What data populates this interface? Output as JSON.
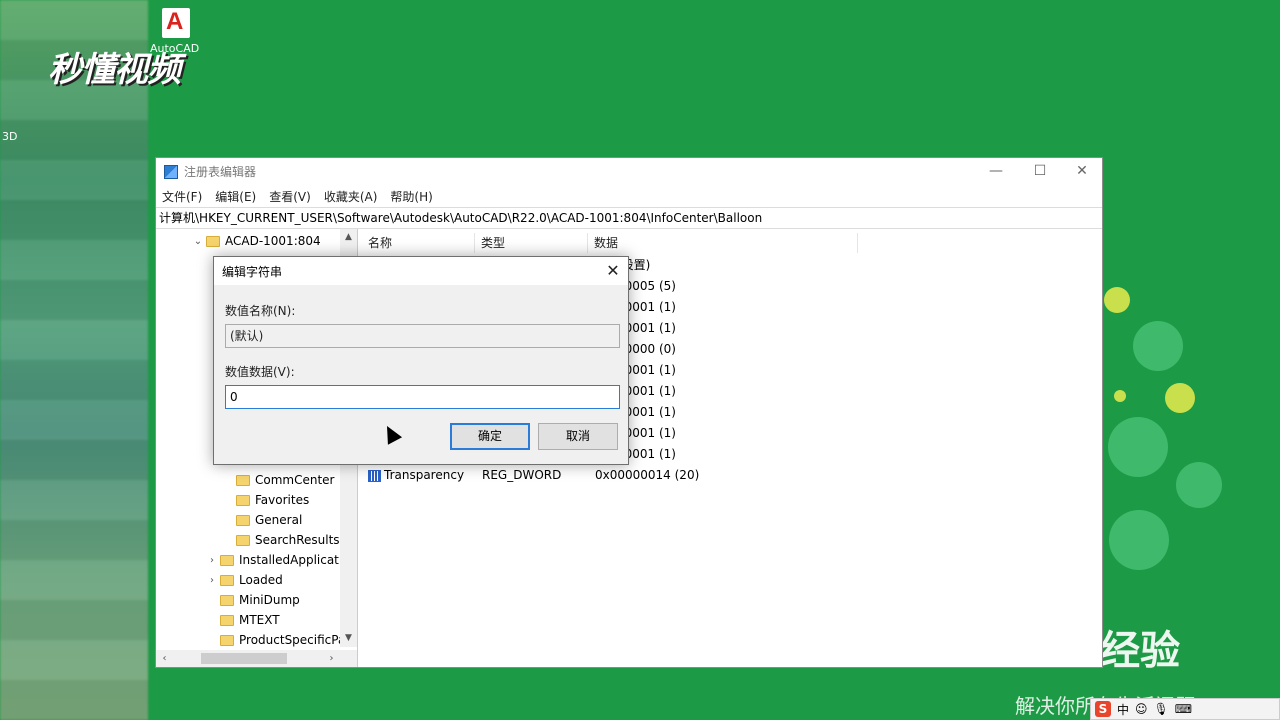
{
  "desktop": {
    "acad_label": "AutoCAD",
    "side_text": "3D",
    "watermark": "秒懂视频"
  },
  "baidu": {
    "logo": "Bai 经验",
    "subtitle": "解决你所有生活问题"
  },
  "tray": {
    "ime": "中",
    "s_logo": "S"
  },
  "window": {
    "title": "注册表编辑器",
    "menu": [
      "文件(F)",
      "编辑(E)",
      "查看(V)",
      "收藏夹(A)",
      "帮助(H)"
    ],
    "address": "计算机\\HKEY_CURRENT_USER\\Software\\Autodesk\\AutoCAD\\R22.0\\ACAD-1001:804\\InfoCenter\\Balloon",
    "controls": {
      "minimize": "—",
      "maximize": "☐",
      "close": "✕"
    }
  },
  "tree": {
    "items": [
      {
        "label": "ACAD-1001:804",
        "chevron": "⌄"
      },
      {
        "label": "CommCenter"
      },
      {
        "label": "Favorites"
      },
      {
        "label": "General"
      },
      {
        "label": "SearchResults"
      },
      {
        "label": "InstalledApplicatio",
        "chevron": "›"
      },
      {
        "label": "Loaded",
        "chevron": "›"
      },
      {
        "label": "MiniDump"
      },
      {
        "label": "MTEXT"
      },
      {
        "label": "ProductSpecificPac"
      }
    ]
  },
  "list": {
    "headers": [
      "名称",
      "类型",
      "数据"
    ],
    "values_partial": [
      "(设置)",
      "00005 (5)",
      "00001 (1)",
      "00001 (1)",
      "00000 (0)",
      "00001 (1)",
      "00001 (1)",
      "00001 (1)",
      "00001 (1)",
      "00001 (1)"
    ],
    "last_row": {
      "name": "Transparency",
      "type": "REG_DWORD",
      "data": "0x00000014 (20)"
    }
  },
  "dialog": {
    "title": "编辑字符串",
    "name_label": "数值名称(N):",
    "name_value": "(默认)",
    "data_label": "数值数据(V):",
    "data_value": "0",
    "ok": "确定",
    "cancel": "取消",
    "close": "✕"
  }
}
